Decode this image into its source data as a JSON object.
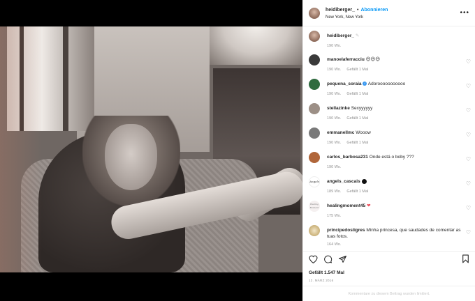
{
  "post": {
    "username": "heidiberger_",
    "follow_label": "Abonnieren",
    "location": "New York, New York",
    "more_icon": "more-dots-icon"
  },
  "caption": {
    "username": "heidiberger_",
    "time": "190 Wo."
  },
  "comments": [
    {
      "user": "manoelaferracciu",
      "text": "😍😍😍",
      "time": "190 Wo.",
      "likes": "Gefällt 1 Mal",
      "avatar_color": "#3a3a3a"
    },
    {
      "user": "pequena_soraia",
      "verified": true,
      "text": "Adorooooooooooo",
      "time": "190 Wo.",
      "likes": "Gefällt 1 Mal",
      "avatar_color": "#2f6b3f"
    },
    {
      "user": "stellazinke",
      "text": "Sexyyyyyy",
      "time": "190 Wo.",
      "likes": "Gefällt 1 Mal",
      "avatar_color": "#9c8f86"
    },
    {
      "user": "emmanellmc",
      "text": "Wooow",
      "time": "190 Wo.",
      "likes": "Gefällt 1 Mal",
      "avatar_color": "#7a7a7a"
    },
    {
      "user": "carlos_barbosa231",
      "text": "Onde está o boby ???",
      "time": "190 Wo.",
      "likes": "",
      "avatar_color": "#b0663a"
    },
    {
      "user": "angels_cascais",
      "text": "",
      "time": "189 Wo.",
      "likes": "Gefällt 1 Mal",
      "avatar_color": "#ffffff"
    },
    {
      "user": "healingmoment45",
      "text": "❤",
      "time": "175 Wo.",
      "likes": "",
      "avatar_color": "#f5f0f0"
    },
    {
      "user": "principedostigres",
      "text": "Minha princesa, que saudades de comentar as tuas fotos.",
      "time": "164 Wo.",
      "likes": "",
      "avatar_color": "#d9c9a8"
    }
  ],
  "actions": {
    "likes_text": "Gefällt 1.547 Mal",
    "date": "12. MÄRZ 2016"
  },
  "footer_text": "Kommentare zu diesem Beitrag wurden limitiert."
}
